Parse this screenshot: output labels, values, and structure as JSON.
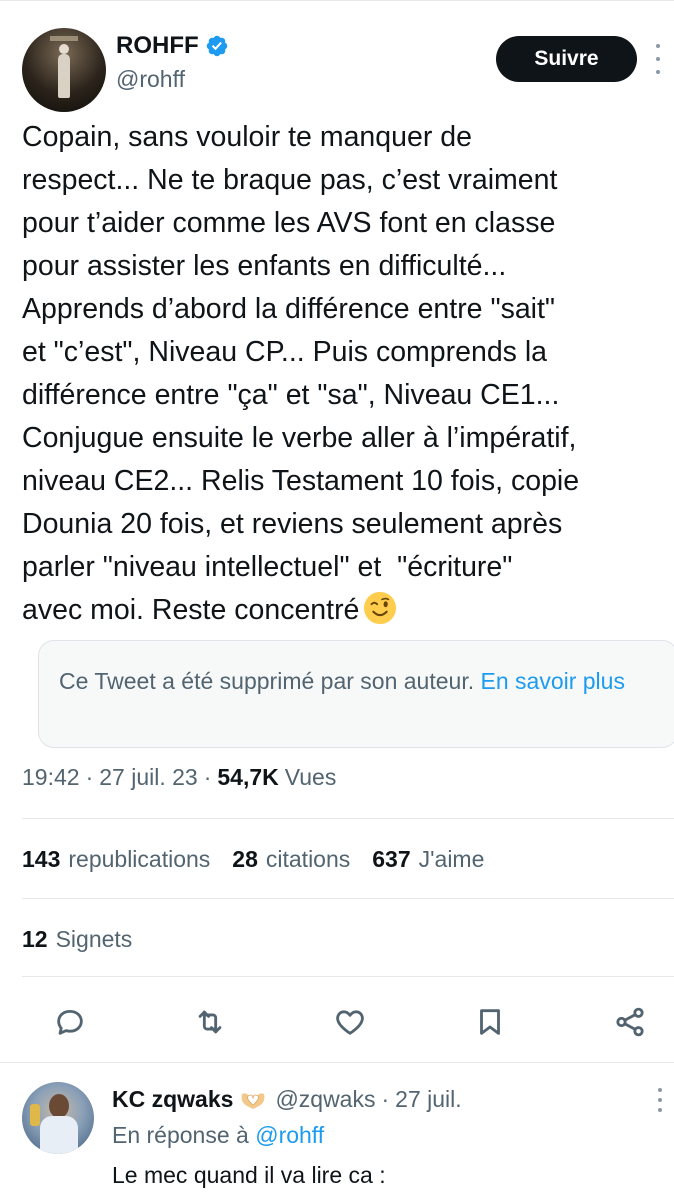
{
  "tweet": {
    "author": {
      "display_name": "ROHFF",
      "handle": "@rohff",
      "verified": true
    },
    "follow_label": "Suivre",
    "text": "Copain, sans vouloir te manquer de\nrespect... Ne te braque pas, c’est vraiment\npour t’aider comme les AVS font en classe\npour assister les enfants en difficulté...\nApprends d’abord la différence entre \"sait\"\net \"c’est\", Niveau CP... Puis comprends la\ndifférence entre \"ça\" et \"sa\", Niveau CE1...\nConjugue ensuite le verbe aller à l’impératif,\nniveau CE2... Relis Testament 10 fois, copie\nDounia 20 fois, et reviens seulement après\nparler \"niveau intellectuel\" et  \"écriture\"\navec moi. Reste concentré",
    "text_emoji": "winking-face",
    "quoted": {
      "message": "Ce Tweet a été supprimé par son auteur.",
      "link": "En savoir plus"
    },
    "meta": {
      "time": "19:42",
      "date": "27 juil. 23",
      "views_count": "54,7K",
      "views_label": "Vues"
    },
    "stats": {
      "reposts_count": "143",
      "reposts_label": "republications",
      "quotes_count": "28",
      "quotes_label": "citations",
      "likes_count": "637",
      "likes_label": "J'aime",
      "bookmarks_count": "12",
      "bookmarks_label": "Signets"
    },
    "actions": [
      "reply-icon",
      "retweet-icon",
      "like-icon",
      "bookmark-icon",
      "share-icon"
    ]
  },
  "reply": {
    "display_name": "KC zqwaks",
    "name_emoji": "heart-hands",
    "handle": "@zqwaks",
    "date": "27 juil.",
    "reply_to_prefix": "En réponse à",
    "reply_to_handle": "@rohff",
    "text": "Le mec quand il va lire ca :"
  },
  "colors": {
    "text_primary": "#0f1419",
    "text_secondary": "#536471",
    "accent_blue": "#1d9bf0",
    "follow_button": "#0f1419"
  }
}
